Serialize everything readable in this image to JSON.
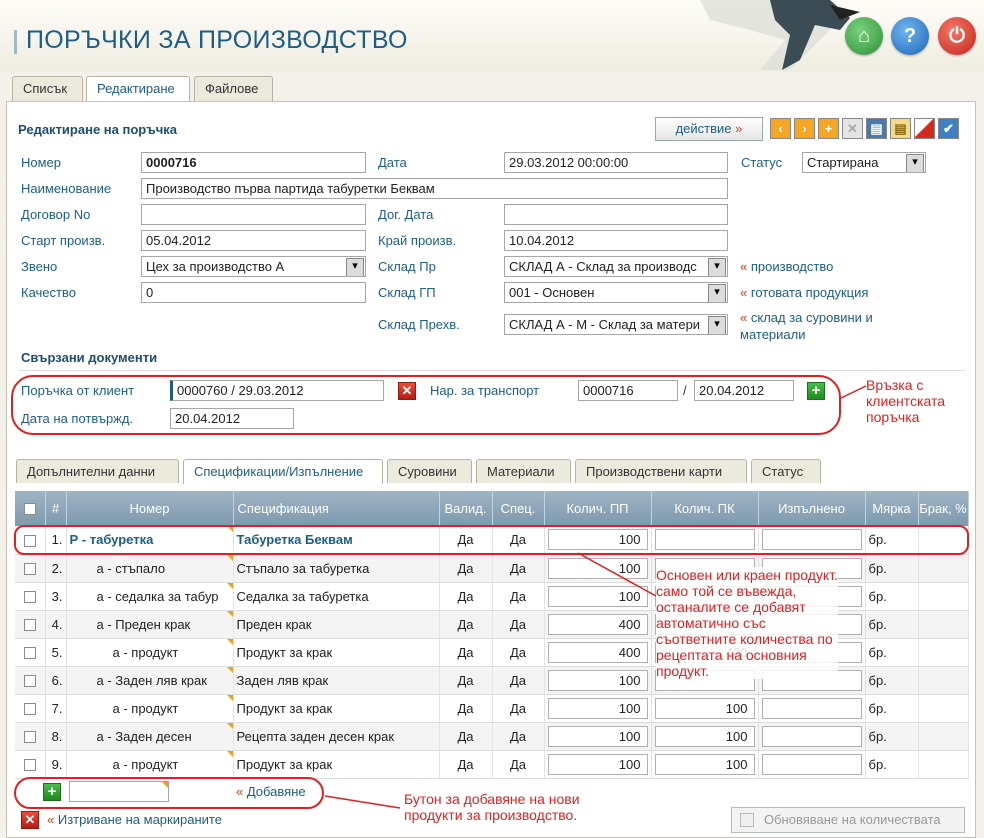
{
  "app": {
    "title": "ПОРЪЧКИ ЗА ПРОИЗВОДСТВО"
  },
  "top_tabs": [
    "Списък",
    "Редактиране",
    "Файлове"
  ],
  "form": {
    "section_title": "Редактиране на поръчка",
    "action_label": "действие",
    "number_label": "Номер",
    "number_value": "0000716",
    "date_label": "Дата",
    "date_value": "29.03.2012 00:00:00",
    "status_label": "Статус",
    "status_value": "Стартирана",
    "name_label": "Наименование",
    "name_value": "Производство първа партида табуретки Беквам",
    "contract_label": "Договор No",
    "contract_value": "",
    "contract_date_label": "Дог. Дата",
    "contract_date_value": "",
    "start_label": "Старт произв.",
    "start_value": "05.04.2012",
    "end_label": "Край произв.",
    "end_value": "10.04.2012",
    "unit_label": "Звено",
    "unit_value": "Цех за производство А",
    "wh_prod_label": "Склад Пр",
    "wh_prod_value": "СКЛАД А - Склад за производс",
    "wh_prod_link": "производство",
    "quality_label": "Качество",
    "quality_value": "0",
    "wh_gp_label": "Склад ГП",
    "wh_gp_value": "001 - Основен",
    "wh_gp_link": "готовата продукция",
    "wh_trans_label": "Склад Прехв.",
    "wh_trans_value": "СКЛАД А - М - Склад за матери",
    "wh_trans_link_1": "склад за суровини и",
    "wh_trans_link_2": "материали"
  },
  "related": {
    "title": "Свързани документи",
    "client_order_label": "Поръчка от клиент",
    "client_order_value": "0000760 / 29.03.2012",
    "transport_label": "Нар. за транспорт",
    "transport_no": "0000716",
    "transport_sep": "/",
    "transport_date": "20.04.2012",
    "confirm_label": "Дата на потвържд.",
    "confirm_value": "20.04.2012"
  },
  "annotations": {
    "client_link_note": "Връзка с\nклиентската\nпоръчка",
    "main_product_note": "Основен или краен продукт.\nсамо той се въвежда,\nостаналите се добавят\nавтоматично със\nсъответните количества по\nрецептата на основния\nпродукт.",
    "add_button_note": "Бутон за добавяне на нови\nпродукти за производство."
  },
  "detail_tabs": [
    "Допълнителни данни",
    "Спецификации/Изпълнение",
    "Суровини",
    "Материали",
    "Производствени карти",
    "Статус"
  ],
  "table": {
    "headers": [
      "",
      "#",
      "Номер",
      "Спецификация",
      "Валид.",
      "Спец.",
      "Колич. ПП",
      "Колич. ПК",
      "Изпълнено",
      "Мярка",
      "Брак, %"
    ],
    "rows": [
      {
        "n": "1.",
        "code": "Р - табуретка",
        "spec": "Табуретка Беквам",
        "valid": "Да",
        "specyn": "Да",
        "pp": "100",
        "pk": "",
        "done": "",
        "unit": "бр."
      },
      {
        "n": "2.",
        "code": "а - стъпало",
        "spec": "Стъпало за табуретка",
        "valid": "Да",
        "specyn": "Да",
        "pp": "100",
        "pk": "",
        "done": "",
        "unit": "бр."
      },
      {
        "n": "3.",
        "code": "а - седалка за табур",
        "spec": "Седалка за табуретка",
        "valid": "Да",
        "specyn": "Да",
        "pp": "100",
        "pk": "",
        "done": "",
        "unit": "бр."
      },
      {
        "n": "4.",
        "code": "а - Преден крак",
        "spec": "Преден крак",
        "valid": "Да",
        "specyn": "Да",
        "pp": "400",
        "pk": "",
        "done": "",
        "unit": "бр."
      },
      {
        "n": "5.",
        "code": "а - продукт",
        "spec": "Продукт за крак",
        "valid": "Да",
        "specyn": "Да",
        "pp": "400",
        "pk": "400",
        "done": "",
        "unit": "бр."
      },
      {
        "n": "6.",
        "code": "а - Заден ляв крак",
        "spec": "Заден ляв крак",
        "valid": "Да",
        "specyn": "Да",
        "pp": "100",
        "pk": "",
        "done": "",
        "unit": "бр."
      },
      {
        "n": "7.",
        "code": "а - продукт",
        "spec": "Продукт за крак",
        "valid": "Да",
        "specyn": "Да",
        "pp": "100",
        "pk": "100",
        "done": "",
        "unit": "бр."
      },
      {
        "n": "8.",
        "code": "а - Заден десен",
        "spec": "Рецепта заден десен крак",
        "valid": "Да",
        "specyn": "Да",
        "pp": "100",
        "pk": "100",
        "done": "",
        "unit": "бр."
      },
      {
        "n": "9.",
        "code": "а - продукт",
        "spec": "Продукт за крак",
        "valid": "Да",
        "specyn": "Да",
        "pp": "100",
        "pk": "100",
        "done": "",
        "unit": "бр."
      }
    ]
  },
  "footer": {
    "add_label": "Добавяне",
    "delete_label": "Изтриване на маркираните",
    "update_label": "Обновяване на количествата"
  },
  "colors": {
    "accent": "#1d5e86",
    "annotation": "#e02020",
    "toolbar_orange": "#f5a623"
  }
}
